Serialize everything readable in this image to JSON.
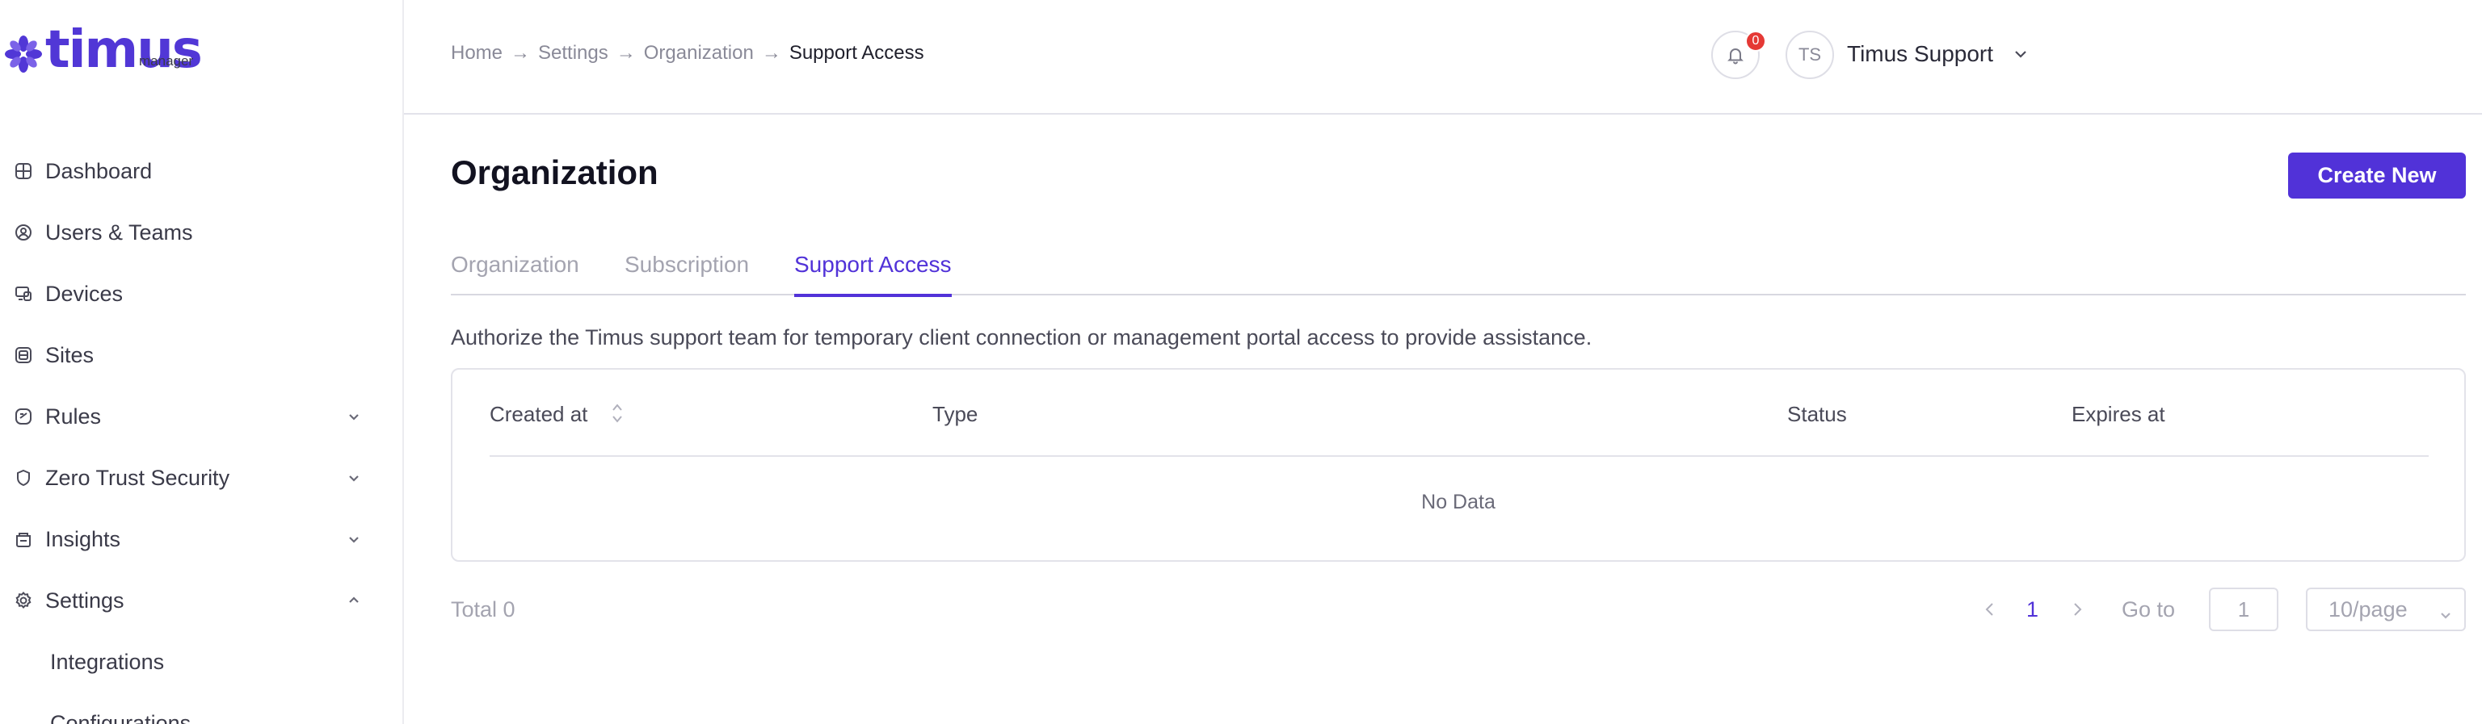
{
  "brand": {
    "name": "timus",
    "sub": "manager",
    "color": "#5137d6"
  },
  "sidebar": {
    "items": [
      {
        "label": "Dashboard",
        "icon": "dashboard-icon",
        "expandable": false
      },
      {
        "label": "Users & Teams",
        "icon": "user-circle-icon",
        "expandable": false
      },
      {
        "label": "Devices",
        "icon": "devices-icon",
        "expandable": false
      },
      {
        "label": "Sites",
        "icon": "sites-icon",
        "expandable": false
      },
      {
        "label": "Rules",
        "icon": "rules-icon",
        "expandable": true,
        "expanded": false
      },
      {
        "label": "Zero Trust Security",
        "icon": "shield-icon",
        "expandable": true,
        "expanded": false
      },
      {
        "label": "Insights",
        "icon": "insights-icon",
        "expandable": true,
        "expanded": false
      },
      {
        "label": "Settings",
        "icon": "gear-icon",
        "expandable": true,
        "expanded": true
      }
    ],
    "sub_items": [
      "Integrations",
      "Configurations"
    ]
  },
  "header": {
    "breadcrumb": [
      "Home",
      "Settings",
      "Organization",
      "Support Access"
    ],
    "notification_count": "0",
    "user_initials": "TS",
    "user_name": "Timus Support"
  },
  "main": {
    "title": "Organization",
    "create_button": "Create New",
    "tabs": [
      {
        "label": "Organization",
        "active": false
      },
      {
        "label": "Subscription",
        "active": false
      },
      {
        "label": "Support Access",
        "active": true
      }
    ],
    "description": "Authorize the Timus support team for temporary client connection or management portal access to provide assistance.",
    "table": {
      "columns": [
        "Created at",
        "Type",
        "Status",
        "Expires at"
      ],
      "rows": [],
      "empty_text": "No Data"
    },
    "pagination": {
      "total": "Total 0",
      "current_page": "1",
      "goto_label": "Go to",
      "goto_value": "1",
      "page_size": "10/page"
    }
  },
  "colors": {
    "accent": "#5132d8",
    "badge": "#e53935"
  }
}
